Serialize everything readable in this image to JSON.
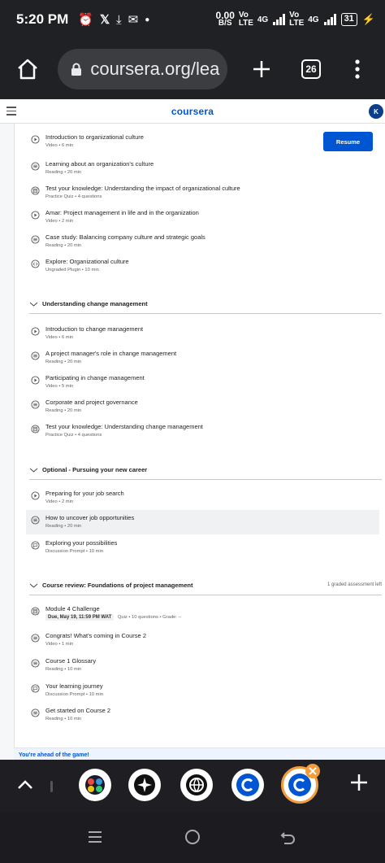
{
  "status_bar": {
    "time": "5:20 PM",
    "net_speed_value": "0.00",
    "net_speed_unit": "B/S",
    "sim1_label": "Vo LTE",
    "sim1_gen": "4G",
    "sim2_label": "Vo LTE",
    "sim2_gen": "4G",
    "battery": "31"
  },
  "browser": {
    "url": "coursera.org/lea",
    "tab_count": "26"
  },
  "site": {
    "logo": "coursera",
    "avatar_initial": "K",
    "resume_label": "Resume"
  },
  "module_a_items": [
    {
      "title": "Introduction to organizational culture",
      "meta": "Video • 6 min",
      "icon": "play-icon"
    },
    {
      "title": "Learning about an organization's culture",
      "meta": "Reading • 20 min",
      "icon": "reading-icon"
    },
    {
      "title": "Test your knowledge: Understanding the impact of organizational culture",
      "meta": "Practice Quiz • 4 questions",
      "icon": "quiz-icon"
    },
    {
      "title": "Amar: Project management in life and in the organization",
      "meta": "Video • 2 min",
      "icon": "play-icon"
    },
    {
      "title": "Case study: Balancing company culture and strategic goals",
      "meta": "Reading • 20 min",
      "icon": "reading-icon"
    },
    {
      "title": "Explore: Organizational culture",
      "meta": "Ungraded Plugin • 10 min",
      "icon": "plugin-icon"
    }
  ],
  "module_b": {
    "title": "Understanding change management",
    "items": [
      {
        "title": "Introduction to change management",
        "meta": "Video • 6 min",
        "icon": "play-icon"
      },
      {
        "title": "A project manager's role in change management",
        "meta": "Reading • 20 min",
        "icon": "reading-icon"
      },
      {
        "title": "Participating in change management",
        "meta": "Video • 5 min",
        "icon": "play-icon"
      },
      {
        "title": "Corporate and project governance",
        "meta": "Reading • 20 min",
        "icon": "reading-icon"
      },
      {
        "title": "Test your knowledge: Understanding change management",
        "meta": "Practice Quiz • 4 questions",
        "icon": "quiz-icon"
      }
    ]
  },
  "module_c": {
    "title": "Optional - Pursuing your new career",
    "items": [
      {
        "title": "Preparing for your job search",
        "meta": "Video • 2 min",
        "icon": "play-icon"
      },
      {
        "title": "How to uncover job opportunities",
        "meta": "Reading • 20 min",
        "icon": "reading-icon"
      },
      {
        "title": "Exploring your possibilities",
        "meta": "Discussion Prompt • 10 min",
        "icon": "discussion-icon"
      }
    ]
  },
  "module_d": {
    "title": "Course review: Foundations of project management",
    "right_note": "1 graded assessment left",
    "challenge": {
      "title": "Module 4 Challenge",
      "due": "Due, May 19, 11:59 PM WAT",
      "meta": "Quiz • 10 questions • Grade: --"
    },
    "items": [
      {
        "title": "Congrats! What's coming in Course 2",
        "meta": "Video • 1 min",
        "icon": "reading-icon"
      },
      {
        "title": "Course 1 Glossary",
        "meta": "Reading • 10 min",
        "icon": "reading-icon"
      },
      {
        "title": "Your learning journey",
        "meta": "Discussion Prompt • 10 min",
        "icon": "discussion-icon"
      },
      {
        "title": "Get started on Course 2",
        "meta": "Reading • 10 min",
        "icon": "reading-icon"
      }
    ]
  },
  "footer_banner": "You're ahead of the game!",
  "colors": {
    "brand": "#0056d2",
    "status_bg": "#202124"
  }
}
